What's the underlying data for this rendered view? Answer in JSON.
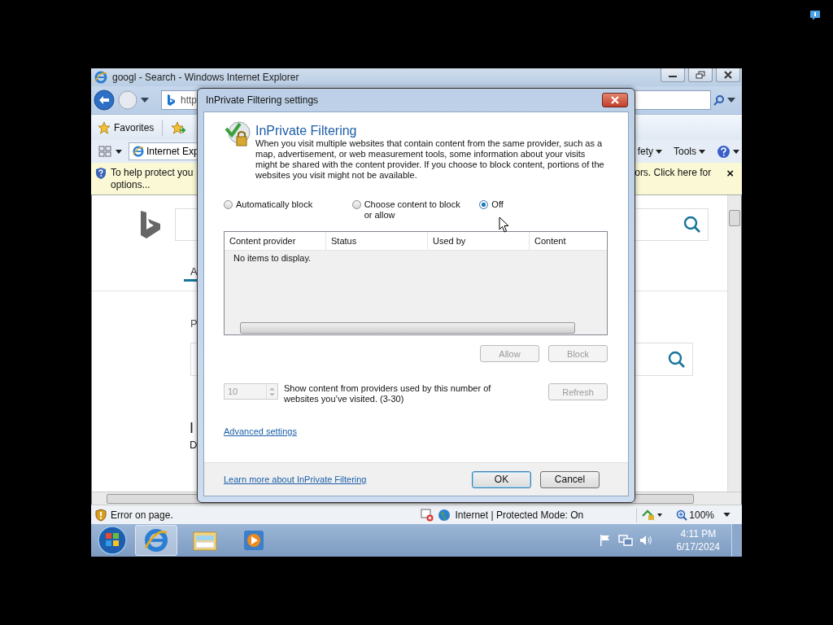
{
  "ie_window": {
    "title": "googl - Search - Windows Internet Explorer",
    "address": "http",
    "favorites_label": "Favorites",
    "tab_label": "Internet Exp",
    "command_items": [
      {
        "label": "fety"
      },
      {
        "label": "Tools"
      }
    ],
    "info_bar": {
      "left_lines": [
        "To help protect you",
        "options..."
      ],
      "right_text": "ors. Click here for",
      "close": "×"
    },
    "page_fragments": {
      "tab": "A",
      "label": "P",
      "heading": "I",
      "line": "D"
    },
    "status_bar": {
      "error": "Error on page.",
      "zone": "Internet | Protected Mode: On",
      "zoom": "100%"
    }
  },
  "taskbar": {
    "time": "4:11 PM",
    "date": "6/17/2024"
  },
  "dialog": {
    "title": "InPrivate Filtering settings",
    "heading": "InPrivate Filtering",
    "description": "When you visit multiple websites that contain content from the same provider, such as a map, advertisement, or web measurement tools, some information about your visits might be shared with the content provider.  If you choose to block content, portions of the websites you visit might not be available.",
    "options": [
      {
        "label": "Automatically block",
        "selected": false
      },
      {
        "label": "Choose content to block or allow",
        "selected": false
      },
      {
        "label": "Off",
        "selected": true
      }
    ],
    "list": {
      "columns": [
        "Content provider",
        "Status",
        "Used by",
        "Content"
      ],
      "empty_text": "No items to display."
    },
    "action_buttons": [
      {
        "label": "Allow",
        "disabled": true
      },
      {
        "label": "Block",
        "disabled": true
      }
    ],
    "threshold": {
      "value": "10",
      "disabled": true,
      "description": "Show content from providers used by this number of websites you’ve visited. (3-30)"
    },
    "refresh_button": {
      "label": "Refresh",
      "disabled": true
    },
    "advanced_link": "Advanced settings",
    "learn_more_link": "Learn more about InPrivate Filtering",
    "buttons": [
      {
        "label": "OK",
        "default": true
      },
      {
        "label": "Cancel",
        "default": false
      }
    ]
  }
}
